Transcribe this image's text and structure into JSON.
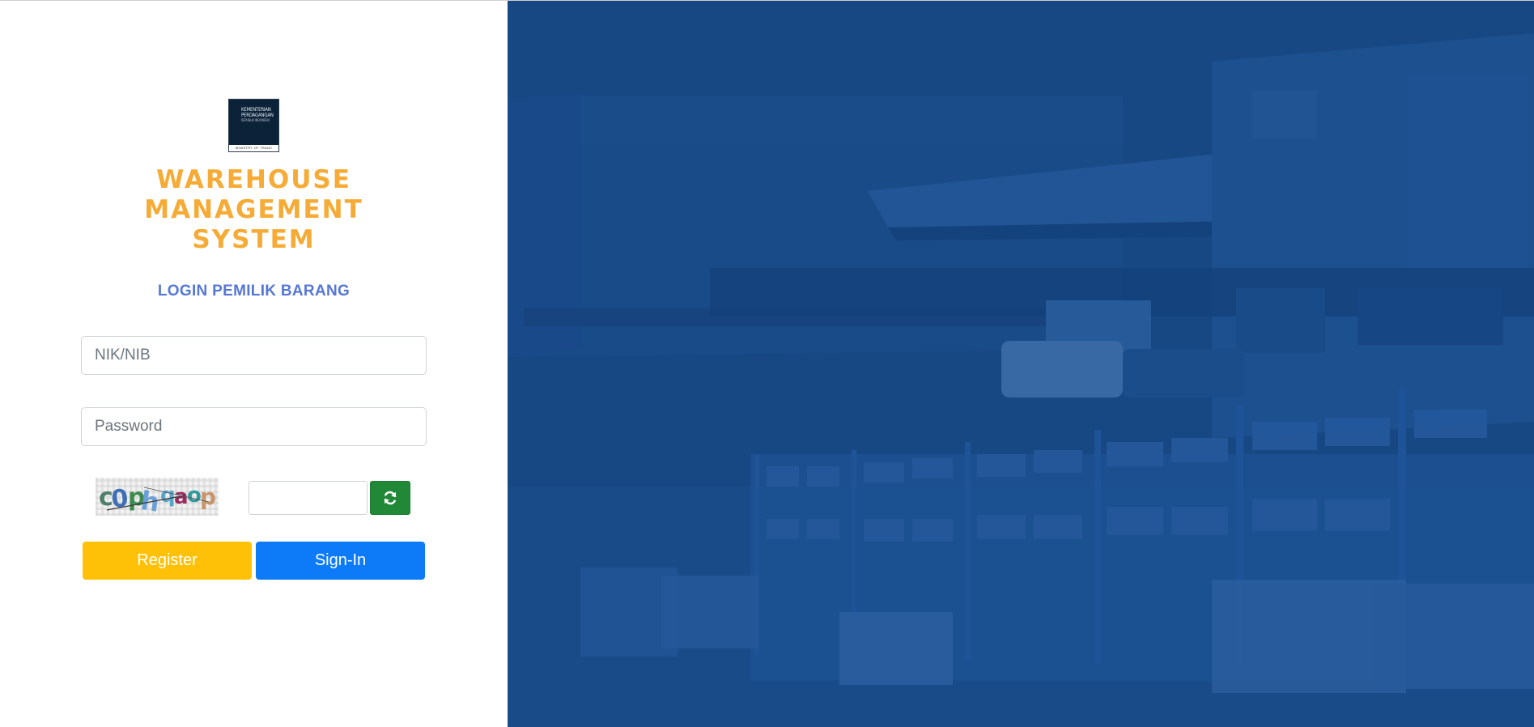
{
  "logo": {
    "lines": [
      "KEMENTERIAN",
      "PERDAGANGAN"
    ],
    "subline": "REPUBLIK INDONESIA",
    "footer": "MINISTRY OF TRADE"
  },
  "app_title": {
    "line1": "WAREHOUSE",
    "line2": "MANAGEMENT",
    "line3": "SYSTEM"
  },
  "login_heading": "LOGIN PEMILIK BARANG",
  "form": {
    "nik_placeholder": "NIK/NIB",
    "nik_value": "",
    "password_placeholder": "Password",
    "password_value": "",
    "captcha_text": "c0phqaop",
    "captcha_value": "",
    "refresh_icon": "refresh-icon",
    "register_label": "Register",
    "signin_label": "Sign-In"
  },
  "colors": {
    "title": "#f5ab35",
    "heading": "#5577d6",
    "register": "#ffc107",
    "signin": "#0d7bf7",
    "refresh": "#218838",
    "hero_overlay": "#1b4e8e"
  }
}
